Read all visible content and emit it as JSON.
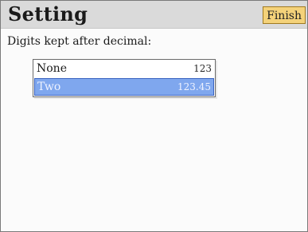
{
  "titlebar": {
    "title": "Setting",
    "finish_label": "Finish"
  },
  "prompt": "Digits kept after decimal:",
  "options": [
    {
      "label": "None",
      "sample": "123"
    },
    {
      "label": "Two",
      "sample": "123.45"
    }
  ],
  "selected_option": "Two",
  "colors": {
    "titlebar_bg": "#dadada",
    "finish_button_bg": "#f4d27a",
    "selected_bg": "#7fa7ee"
  }
}
